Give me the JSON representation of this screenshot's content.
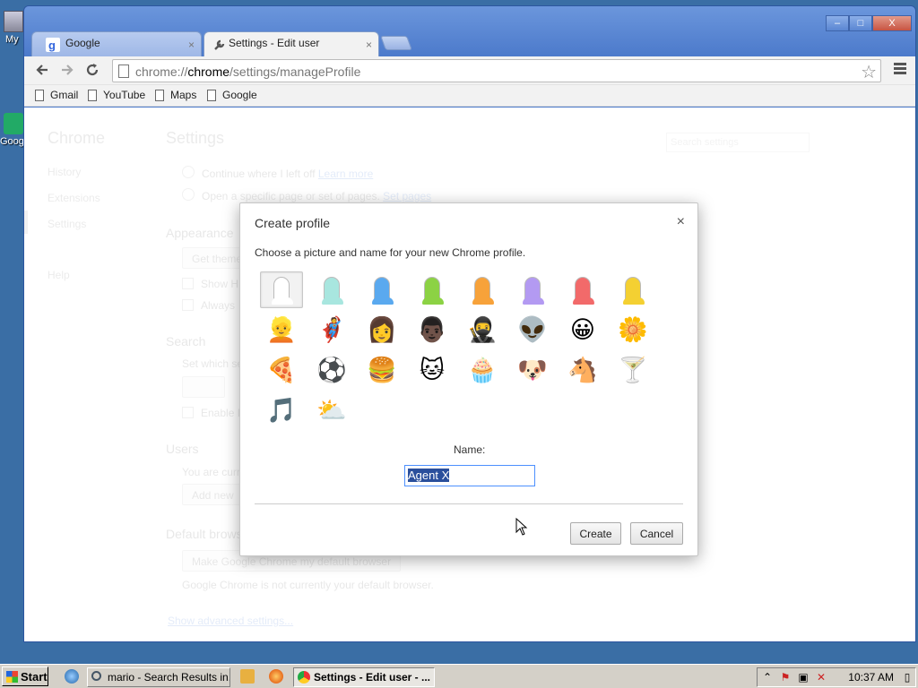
{
  "desktop": {
    "icon1_label": "My",
    "icon2_label": "Goog"
  },
  "browser": {
    "tabs": [
      {
        "label": "Google",
        "active": false
      },
      {
        "label": "Settings - Edit user",
        "active": true
      }
    ],
    "tab_close_glyph": "×",
    "url_prefix": "chrome://",
    "url_host": "chrome",
    "url_path": "/settings/manageProfile",
    "bookmarks": [
      "Gmail",
      "YouTube",
      "Maps",
      "Google"
    ],
    "window_controls": {
      "minimize": "–",
      "maximize": "□",
      "close": "X"
    }
  },
  "settings_page": {
    "sidebar_title": "Chrome",
    "sidebar_items": [
      "History",
      "Extensions",
      "Settings",
      "Help"
    ],
    "title": "Settings",
    "search_placeholder": "Search settings",
    "on_startup_option1": "Continue where I left off",
    "on_startup_link1": "Learn more",
    "on_startup_option2": "Open a specific page or set of pages.",
    "on_startup_link2": "Set pages",
    "appearance_heading": "Appearance",
    "get_themes_button": "Get theme",
    "show_home_label": "Show H",
    "always_show_label": "Always",
    "search_heading": "Search",
    "search_desc": "Set which se",
    "enable_label": "Enable I",
    "users_heading": "Users",
    "users_desc": "You are curr",
    "add_user_button": "Add new",
    "default_browser_heading": "Default brows",
    "default_browser_button": "Make Google Chrome my default browser",
    "default_browser_note": "Google Chrome is not currently your default browser.",
    "advanced_link": "Show advanced settings..."
  },
  "dialog": {
    "title": "Create profile",
    "close_glyph": "×",
    "description": "Choose a picture and name for your new Chrome profile.",
    "avatars": [
      {
        "name": "generic-white",
        "kind": "sil",
        "color": "#ffffff"
      },
      {
        "name": "generic-aqua",
        "kind": "sil",
        "color": "#a8e6df"
      },
      {
        "name": "generic-blue",
        "kind": "sil",
        "color": "#5aa9ef"
      },
      {
        "name": "generic-green",
        "kind": "sil",
        "color": "#8cd244"
      },
      {
        "name": "generic-orange",
        "kind": "sil",
        "color": "#f7a23a"
      },
      {
        "name": "generic-purple",
        "kind": "sil",
        "color": "#b39af2"
      },
      {
        "name": "generic-red",
        "kind": "sil",
        "color": "#f26a6a"
      },
      {
        "name": "generic-yellow",
        "kind": "sil",
        "color": "#f4d032"
      },
      {
        "name": "secret-agent",
        "kind": "emoji",
        "glyph": "👱"
      },
      {
        "name": "superhero",
        "kind": "emoji",
        "glyph": "🦸"
      },
      {
        "name": "volleyball",
        "kind": "emoji",
        "glyph": "👩"
      },
      {
        "name": "businessman",
        "kind": "emoji",
        "glyph": "👨🏿"
      },
      {
        "name": "ninja",
        "kind": "emoji",
        "glyph": "🥷"
      },
      {
        "name": "alien",
        "kind": "emoji",
        "glyph": "👽"
      },
      {
        "name": "awesome",
        "kind": "emoji",
        "glyph": "😀"
      },
      {
        "name": "flower",
        "kind": "emoji",
        "glyph": "🌼"
      },
      {
        "name": "pizza",
        "kind": "emoji",
        "glyph": "🍕"
      },
      {
        "name": "soccer",
        "kind": "emoji",
        "glyph": "⚽"
      },
      {
        "name": "burger",
        "kind": "emoji",
        "glyph": "🍔"
      },
      {
        "name": "cat",
        "kind": "emoji",
        "glyph": "🐱"
      },
      {
        "name": "cupcake",
        "kind": "emoji",
        "glyph": "🧁"
      },
      {
        "name": "dog",
        "kind": "emoji",
        "glyph": "🐶"
      },
      {
        "name": "horse",
        "kind": "emoji",
        "glyph": "🐴"
      },
      {
        "name": "margarita",
        "kind": "emoji",
        "glyph": "🍸"
      },
      {
        "name": "note",
        "kind": "emoji",
        "glyph": "🎵"
      },
      {
        "name": "sun-cloud",
        "kind": "emoji",
        "glyph": "⛅"
      }
    ],
    "selected_avatar_index": 0,
    "name_label": "Name:",
    "name_value": "Agent X",
    "create_button": "Create",
    "cancel_button": "Cancel"
  },
  "taskbar": {
    "start_label": "Start",
    "items": [
      {
        "label": "mario - Search Results in...",
        "active": false
      },
      {
        "label": "Settings - Edit user - ...",
        "active": true
      }
    ],
    "clock": "10:37 AM"
  },
  "colors": {
    "desktop": "#3a6ea5",
    "window_frame": "#4a79c9",
    "link": "#1155cc",
    "selection": "#2a4f9c",
    "focus": "#4d90fe"
  }
}
